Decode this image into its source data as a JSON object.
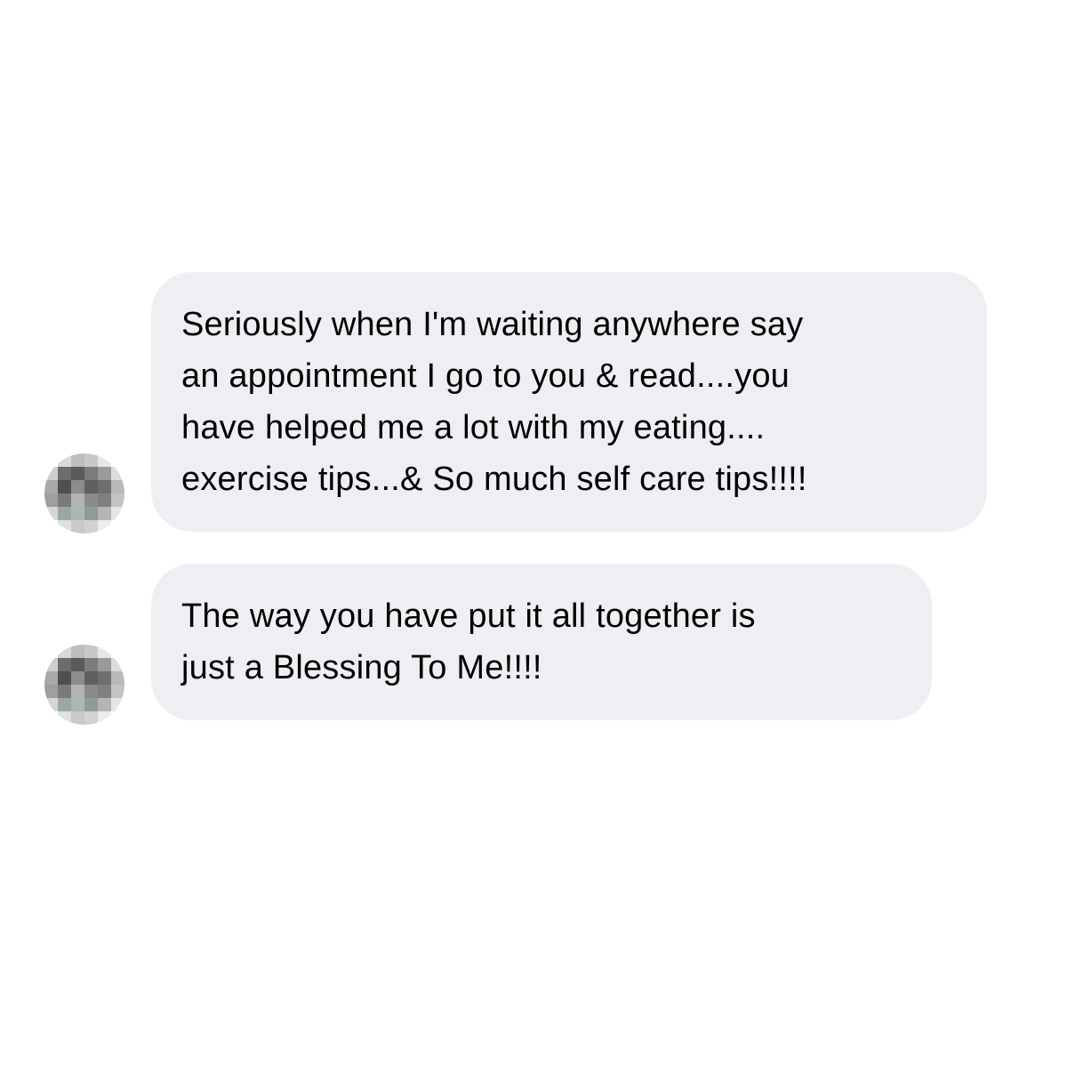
{
  "messages": [
    {
      "text": "Seriously when I'm waiting anywhere say\nan appointment I go to you & read....you\nhave helped me a lot with my eating....\nexercise tips...& So much self care tips!!!!"
    },
    {
      "text": "The way you have put it all together is\njust a Blessing To Me!!!!"
    }
  ],
  "colors": {
    "background": "#ffffff",
    "bubble": "#efeff3",
    "text": "#000000"
  },
  "avatar": {
    "description_icon": "pixelated-avatar-icon"
  }
}
